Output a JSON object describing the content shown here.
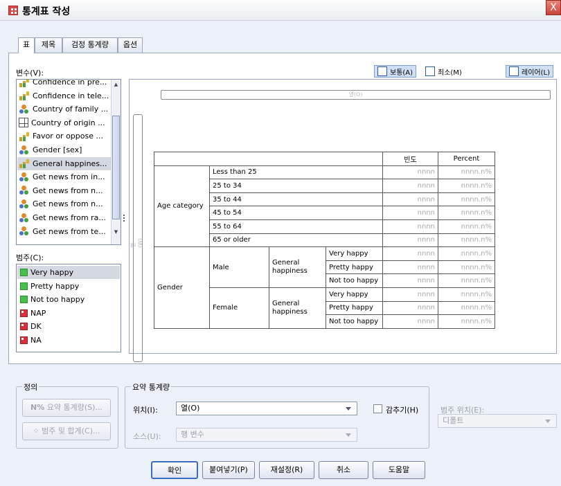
{
  "window": {
    "title": "통계표 작성",
    "close": "X"
  },
  "tabs": [
    "표",
    "제목",
    "검정 통계량",
    "옵션"
  ],
  "variables": {
    "label": "변수(V):",
    "items": [
      {
        "label": "Confidence in pre...",
        "icon": "scale"
      },
      {
        "label": "Confidence in tele...",
        "icon": "scale"
      },
      {
        "label": "Country of family ...",
        "icon": "nominal"
      },
      {
        "label": "Country of origin ...",
        "icon": "grid"
      },
      {
        "label": "Favor or oppose ...",
        "icon": "scale"
      },
      {
        "label": "Gender [sex]",
        "icon": "nominal"
      },
      {
        "label": "General happines...",
        "icon": "scale",
        "selected": true
      },
      {
        "label": "Get news from in...",
        "icon": "nominal"
      },
      {
        "label": "Get news from n...",
        "icon": "nominal"
      },
      {
        "label": "Get news from n...",
        "icon": "nominal"
      },
      {
        "label": "Get news from ra...",
        "icon": "nominal"
      },
      {
        "label": "Get news from te...",
        "icon": "nominal"
      }
    ]
  },
  "categories": {
    "label": "범주(C):",
    "items": [
      {
        "label": "Very happy",
        "icon": "green",
        "selected": true
      },
      {
        "label": "Pretty happy",
        "icon": "green"
      },
      {
        "label": "Not too happy",
        "icon": "green"
      },
      {
        "label": "NAP",
        "icon": "red"
      },
      {
        "label": "DK",
        "icon": "red"
      },
      {
        "label": "NA",
        "icon": "red"
      }
    ]
  },
  "toolbar": {
    "normal": "보통(A)",
    "compact": "최소(M)",
    "layers": "레이어(L)"
  },
  "canvas": {
    "column_zone": "열(O)",
    "row_zone": "행(W)",
    "headers": [
      "빈도",
      "Percent"
    ],
    "age_label": "Age category",
    "age_rows": [
      "Less than 25",
      "25 to 34",
      "35 to 44",
      "45 to 54",
      "55 to 64",
      "65 or older"
    ],
    "gender_label": "Gender",
    "male": "Male",
    "female": "Female",
    "happiness": "General happiness",
    "happy_rows": [
      "Very happy",
      "Pretty happy",
      "Not too happy"
    ],
    "count_placeholder": "nnnn",
    "pct_placeholder": "nnnn.n%"
  },
  "define": {
    "title": "정의",
    "summary_btn": "요약 통계량(S)...",
    "summary_symbol": "N%",
    "categories_btn": "범주 및 합계(C)..."
  },
  "summary": {
    "title": "요약 통계량",
    "position_label": "위치(I):",
    "position_value": "열(O)",
    "hide_label": "감추기(H)",
    "source_label": "소스(U):",
    "source_value": "행 변수",
    "cat_position_label": "범주 위치(E):",
    "cat_position_value": "디폴트"
  },
  "buttons": {
    "ok": "확인",
    "paste": "붙여넣기(P)",
    "reset": "재설정(R)",
    "cancel": "취소",
    "help": "도움말"
  }
}
